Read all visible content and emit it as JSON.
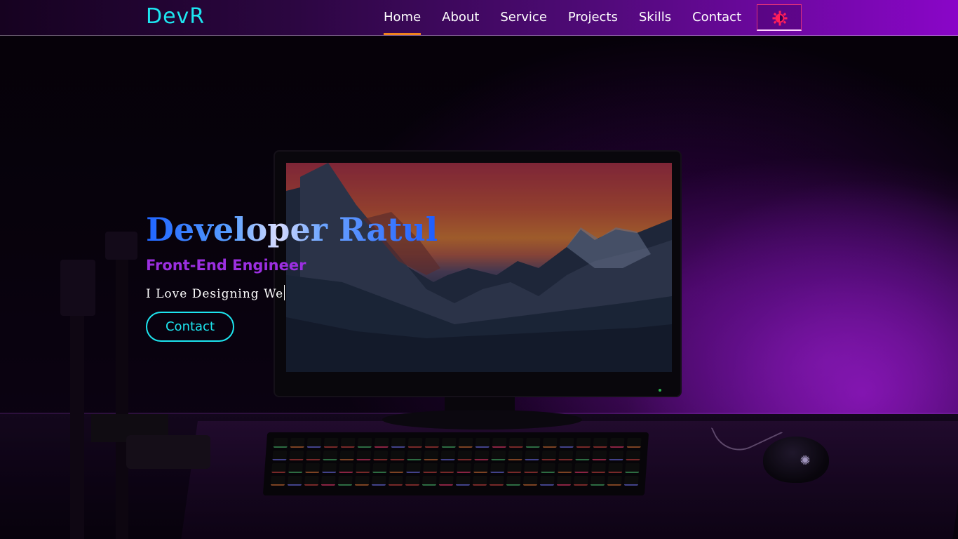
{
  "nav": {
    "logo": "DevR",
    "links": [
      {
        "label": "Home",
        "active": true
      },
      {
        "label": "About",
        "active": false
      },
      {
        "label": "Service",
        "active": false
      },
      {
        "label": "Projects",
        "active": false
      },
      {
        "label": "Skills",
        "active": false
      },
      {
        "label": "Contact",
        "active": false
      }
    ],
    "theme_toggle_icon": "brightness-icon"
  },
  "hero": {
    "title": "Developer Ratul",
    "subtitle": "Front-End Engineer",
    "typed_text": "I Love Designing We",
    "button_label": "Contact"
  },
  "colors": {
    "accent_cyan": "#1de6f0",
    "nav_active_underline": "#f0831e",
    "subtitle_purple": "#9b2fe0",
    "theme_icon": "#ff1f5a",
    "title_blue": "#1f64ff"
  }
}
